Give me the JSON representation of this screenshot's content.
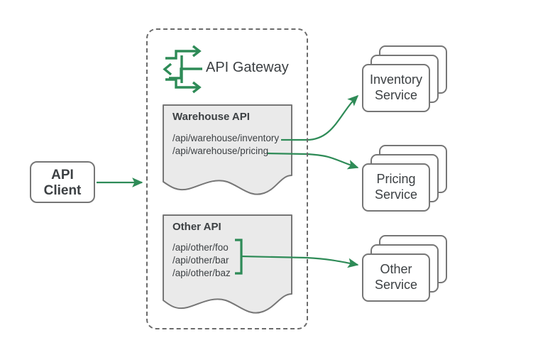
{
  "diagram": {
    "title": "API Gateway routing diagram",
    "colors": {
      "arrow_green": "#2e8b57",
      "box_border_gray": "#767676",
      "dashed_border_gray": "#6b6b6b",
      "doc_fill_gray": "#eaeaea",
      "text_dark": "#3c4043"
    }
  },
  "client": {
    "name": "API Client",
    "line1": "API",
    "line2": "Client",
    "label": "API\nClient"
  },
  "gateway": {
    "title": "API Gateway",
    "icon": "api-exchange-arrows-icon",
    "apis": [
      {
        "id": "warehouse",
        "title": "Warehouse API",
        "paths": [
          "/api/warehouse/inventory",
          "/api/warehouse/pricing"
        ],
        "paths_text": "/api/warehouse/inventory\n/api/warehouse/pricing",
        "grouped": false
      },
      {
        "id": "other",
        "title": "Other API",
        "paths": [
          "/api/other/foo",
          "/api/other/bar",
          "/api/other/baz"
        ],
        "paths_text": "/api/other/foo\n/api/other/bar\n/api/other/baz",
        "grouped": true
      }
    ]
  },
  "services": [
    {
      "id": "inventory",
      "line1": "Inventory",
      "line2": "Service",
      "label": "Inventory\nService",
      "instances": 3
    },
    {
      "id": "pricing",
      "line1": "Pricing",
      "line2": "Service",
      "label": "Pricing\nService",
      "instances": 3
    },
    {
      "id": "other",
      "line1": "Other",
      "line2": "Service",
      "label": "Other\nService",
      "instances": 3
    }
  ],
  "connections": [
    {
      "id": "client-to-gateway",
      "from": "API Client",
      "to": "API Gateway"
    },
    {
      "id": "inventory-route",
      "from": "/api/warehouse/inventory",
      "to": "Inventory Service"
    },
    {
      "id": "pricing-route",
      "from": "/api/warehouse/pricing",
      "to": "Pricing Service"
    },
    {
      "id": "other-route",
      "from": "/api/other/*",
      "to": "Other Service"
    }
  ]
}
